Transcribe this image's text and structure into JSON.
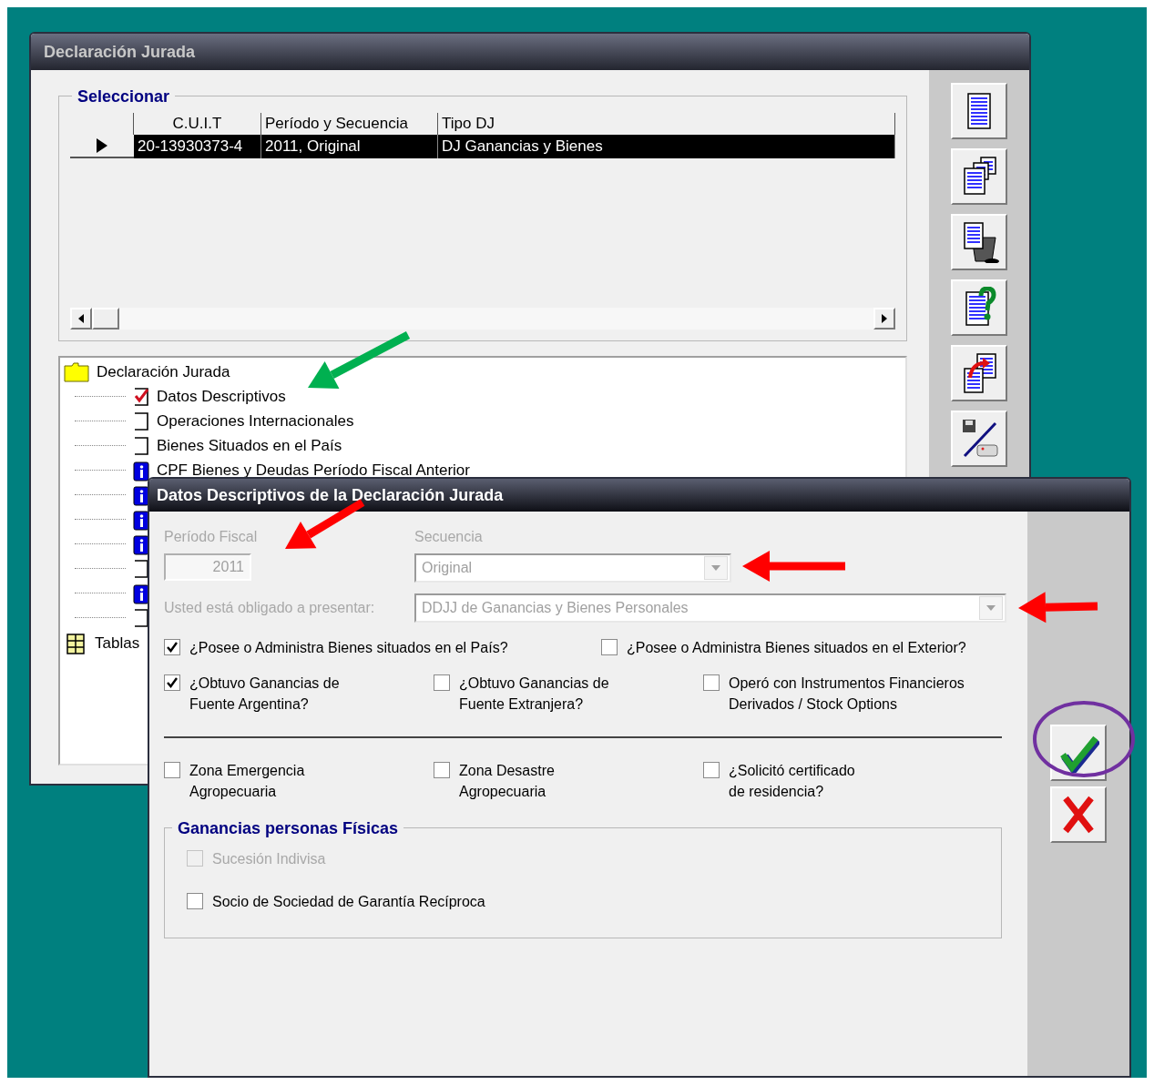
{
  "main_window": {
    "title": "Declaración Jurada",
    "select_group": {
      "title": "Seleccionar",
      "columns": [
        "C.U.I.T",
        "Período y Secuencia",
        "Tipo DJ"
      ],
      "rows": [
        {
          "selected": true,
          "cells": [
            "20-13930373-4",
            "2011, Original",
            "DJ Ganancias y Bienes"
          ]
        }
      ]
    },
    "tree": {
      "label": "Declaración Jurada",
      "children": [
        {
          "kind": "check",
          "label": "Datos Descriptivos",
          "checked": true
        },
        {
          "kind": "check",
          "label": "Operaciones Internacionales",
          "checked": false
        },
        {
          "kind": "check",
          "label": "Bienes Situados en el País",
          "checked": false
        },
        {
          "kind": "info",
          "label": "CPF Bienes y Deudas Período Fiscal Anterior"
        },
        {
          "kind": "info"
        },
        {
          "kind": "info"
        },
        {
          "kind": "info"
        },
        {
          "kind": "check",
          "checked": false
        },
        {
          "kind": "info"
        },
        {
          "kind": "check",
          "checked": false
        }
      ],
      "tables": {
        "label": "Tablas"
      }
    },
    "toolbar": [
      {
        "kind": "list"
      },
      {
        "kind": "copy"
      },
      {
        "kind": "delete"
      },
      {
        "kind": "help"
      },
      {
        "kind": "import"
      },
      {
        "kind": "save_print"
      }
    ]
  },
  "dialog": {
    "title": "Datos Descriptivos de la Declaración Jurada",
    "fiscal_period": {
      "label": "Período Fiscal",
      "value": "2011",
      "disabled": true
    },
    "sequence": {
      "label": "Secuencia",
      "value": "Original",
      "disabled": true
    },
    "obligation": {
      "label": "Usted está obligado a presentar:",
      "value": "DDJJ de Ganancias y Bienes Personales",
      "disabled": true
    },
    "question_rows": [
      [
        {
          "label": "¿Posee o Administra Bienes situados en el País?",
          "checked": true
        },
        {
          "label": "¿Posee o Administra Bienes situados en el Exterior?",
          "checked": false
        }
      ],
      [
        {
          "label": "¿Obtuvo Ganancias de\nFuente Argentina?",
          "checked": true
        },
        {
          "label": "¿Obtuvo Ganancias de\nFuente Extranjera?",
          "checked": false
        },
        {
          "label": "Operó con Instrumentos Financieros\nDerivados / Stock Options",
          "checked": false
        }
      ]
    ],
    "zone_row": [
      {
        "label": "Zona Emergencia\nAgropecuaria",
        "checked": false
      },
      {
        "label": "Zona Desastre\nAgropecuaria",
        "checked": false
      },
      {
        "label": "¿Solicitó certificado\nde residencia?",
        "checked": false
      }
    ],
    "group": {
      "title": "Ganancias personas Físicas",
      "items": [
        {
          "label": "Sucesión Indivisa",
          "checked": false,
          "disabled": true
        },
        {
          "label": "Socio de Sociedad de Garantía Recíproca",
          "checked": false,
          "disabled": false
        }
      ]
    },
    "buttons": [
      {
        "kind": "ok"
      },
      {
        "kind": "cancel"
      }
    ]
  },
  "annotations": [
    {
      "kind": "arrow",
      "color": "#00b050"
    },
    {
      "kind": "arrow",
      "color": "#ff0000"
    },
    {
      "kind": "arrow",
      "color": "#ff0000"
    },
    {
      "kind": "arrow",
      "color": "#ff0000"
    },
    {
      "kind": "ellipse",
      "color": "#7030a0"
    }
  ]
}
